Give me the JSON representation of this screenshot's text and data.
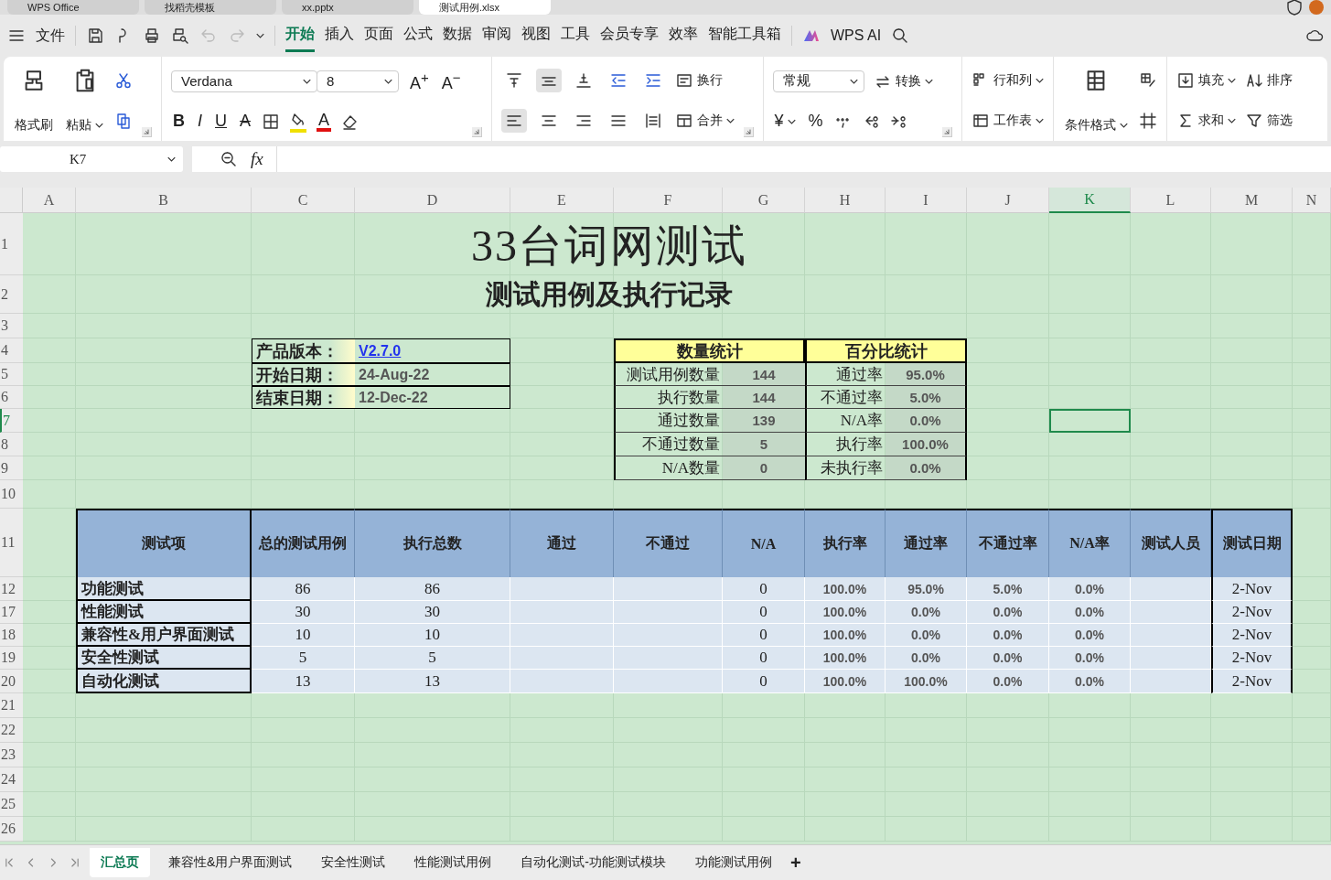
{
  "app_tabs": [
    {
      "label": "WPS Office",
      "selected": false
    },
    {
      "label": "找稻壳模板",
      "selected": false
    },
    {
      "label": "xx.pptx",
      "selected": false
    },
    {
      "label": "测试用例.xlsx",
      "selected": true
    }
  ],
  "menu": {
    "file": "文件",
    "tabs": [
      {
        "label": "开始",
        "selected": true
      },
      {
        "label": "插入",
        "selected": false
      },
      {
        "label": "页面",
        "selected": false
      },
      {
        "label": "公式",
        "selected": false
      },
      {
        "label": "数据",
        "selected": false
      },
      {
        "label": "审阅",
        "selected": false
      },
      {
        "label": "视图",
        "selected": false
      },
      {
        "label": "工具",
        "selected": false
      },
      {
        "label": "会员专享",
        "selected": false
      },
      {
        "label": "效率",
        "selected": false
      },
      {
        "label": "智能工具箱",
        "selected": false
      }
    ],
    "ai": "WPS AI"
  },
  "ribbon": {
    "format_painter": "格式刷",
    "paste": "粘贴",
    "font": "Verdana",
    "size": "8",
    "grow": "A$^{+}$",
    "shrink": "A$^{−}$",
    "bold": "B",
    "italic": "I",
    "underline": "U",
    "strike": "A",
    "font_color": "A",
    "wrap": "换行",
    "merge": "合并",
    "number_format": "常规",
    "convert": "转换",
    "currency": "¥",
    "percent": "%",
    "rows_cols": "行和列",
    "worksheet": "工作表",
    "cond_format": "条件格式",
    "fill": "填充",
    "sort": "排序",
    "sum": "求和",
    "filter": "筛选",
    "align_vertical": [
      {
        "kind": "top",
        "selected": false
      },
      {
        "kind": "middle",
        "selected": true
      },
      {
        "kind": "bottom",
        "selected": false
      },
      {
        "kind": "outdent",
        "selected": false
      },
      {
        "kind": "indent",
        "selected": false
      }
    ],
    "align_horizontal": [
      {
        "kind": "left",
        "selected": true
      },
      {
        "kind": "center",
        "selected": false
      },
      {
        "kind": "right",
        "selected": false
      },
      {
        "kind": "justify",
        "selected": false
      },
      {
        "kind": "distributed",
        "selected": false
      }
    ]
  },
  "formula_bar": {
    "name_box": "K7",
    "fx": "fx"
  },
  "columns": [
    {
      "label": "A",
      "selected": false
    },
    {
      "label": "B",
      "selected": false
    },
    {
      "label": "C",
      "selected": false
    },
    {
      "label": "D",
      "selected": false
    },
    {
      "label": "E",
      "selected": false
    },
    {
      "label": "F",
      "selected": false
    },
    {
      "label": "G",
      "selected": false
    },
    {
      "label": "H",
      "selected": false
    },
    {
      "label": "I",
      "selected": false
    },
    {
      "label": "J",
      "selected": false
    },
    {
      "label": "K",
      "selected": true
    },
    {
      "label": "L",
      "selected": false
    },
    {
      "label": "M",
      "selected": false
    },
    {
      "label": "N",
      "selected": false
    }
  ],
  "rows": [
    {
      "label": "1",
      "selected": false
    },
    {
      "label": "2",
      "selected": false
    },
    {
      "label": "3",
      "selected": false
    },
    {
      "label": "4",
      "selected": false
    },
    {
      "label": "5",
      "selected": false
    },
    {
      "label": "6",
      "selected": false
    },
    {
      "label": "7",
      "selected": true
    },
    {
      "label": "8",
      "selected": false
    },
    {
      "label": "9",
      "selected": false
    },
    {
      "label": "10",
      "selected": false
    },
    {
      "label": "11",
      "selected": false
    },
    {
      "label": "12",
      "selected": false
    },
    {
      "label": "17",
      "selected": false
    },
    {
      "label": "18",
      "selected": false
    },
    {
      "label": "19",
      "selected": false
    },
    {
      "label": "20",
      "selected": false
    },
    {
      "label": "21",
      "selected": false
    },
    {
      "label": "22",
      "selected": false
    },
    {
      "label": "23",
      "selected": false
    },
    {
      "label": "24",
      "selected": false
    },
    {
      "label": "25",
      "selected": false
    },
    {
      "label": "26",
      "selected": false
    }
  ],
  "sheet": {
    "title": "33台词网测试",
    "subtitle": "测试用例及执行记录",
    "info": [
      {
        "label": "产品版本：",
        "value": "V2.7.0",
        "kind": "link"
      },
      {
        "label": "开始日期：",
        "value": "24-Aug-22",
        "kind": "text"
      },
      {
        "label": "结束日期：",
        "value": "12-Dec-22",
        "kind": "text"
      }
    ],
    "stats": {
      "count_header": "数量统计",
      "pct_header": "百分比统计",
      "rows": [
        {
          "label": "测试用例数量",
          "value": "144",
          "pct_label": "通过率",
          "pct_value": "95.0%"
        },
        {
          "label": "执行数量",
          "value": "144",
          "pct_label": "不通过率",
          "pct_value": "5.0%"
        },
        {
          "label": "通过数量",
          "value": "139",
          "pct_label": "N/A率",
          "pct_value": "0.0%"
        },
        {
          "label": "不通过数量",
          "value": "5",
          "pct_label": "执行率",
          "pct_value": "100.0%"
        },
        {
          "label": "N/A数量",
          "value": "0",
          "pct_label": "未执行率",
          "pct_value": "0.0%"
        }
      ]
    },
    "table": {
      "columns": [
        "测试项",
        "总的测试用例",
        "执行总数",
        "通过",
        "不通过",
        "N/A",
        "执行率",
        "通过率",
        "不通过率",
        "N/A率",
        "测试人员",
        "测试日期"
      ],
      "rows": [
        {
          "item": "功能测试",
          "total": "86",
          "executed": "86",
          "na": "0",
          "exec_rate": "100.0%",
          "pass_rate": "95.0%",
          "fail_rate": "5.0%",
          "na_rate": "0.0%",
          "date": "2-Nov"
        },
        {
          "item": "性能测试",
          "total": "30",
          "executed": "30",
          "na": "0",
          "exec_rate": "100.0%",
          "pass_rate": "0.0%",
          "fail_rate": "0.0%",
          "na_rate": "0.0%",
          "date": "2-Nov"
        },
        {
          "item": "兼容性&用户界面测试",
          "total": "10",
          "executed": "10",
          "na": "0",
          "exec_rate": "100.0%",
          "pass_rate": "0.0%",
          "fail_rate": "0.0%",
          "na_rate": "0.0%",
          "date": "2-Nov"
        },
        {
          "item": "安全性测试",
          "total": "5",
          "executed": "5",
          "na": "0",
          "exec_rate": "100.0%",
          "pass_rate": "0.0%",
          "fail_rate": "0.0%",
          "na_rate": "0.0%",
          "date": "2-Nov"
        },
        {
          "item": "自动化测试",
          "total": "13",
          "executed": "13",
          "na": "0",
          "exec_rate": "100.0%",
          "pass_rate": "100.0%",
          "fail_rate": "0.0%",
          "na_rate": "0.0%",
          "date": "2-Nov"
        }
      ]
    }
  },
  "sheet_tabs": [
    {
      "label": "汇总页",
      "selected": true
    },
    {
      "label": "兼容性&用户界面测试",
      "selected": false
    },
    {
      "label": "安全性测试",
      "selected": false
    },
    {
      "label": "性能测试用例",
      "selected": false
    },
    {
      "label": "自动化测试-功能测试模块",
      "selected": false
    },
    {
      "label": "功能测试用例",
      "selected": false
    }
  ],
  "add_sheet": "+"
}
